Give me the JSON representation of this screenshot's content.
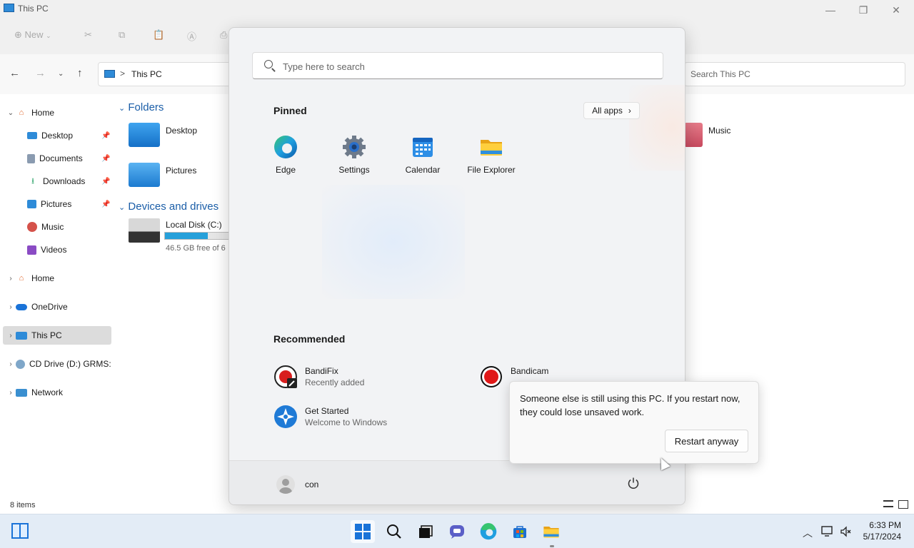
{
  "explorer": {
    "title": "This PC",
    "toolbar": {
      "new_label": "New"
    },
    "address": {
      "crumb": "This PC",
      "separator": ">"
    },
    "search_placeholder": "Search This PC",
    "nav": {
      "items": [
        {
          "label": "Home",
          "pinned": false
        },
        {
          "label": "Desktop",
          "pinned": true
        },
        {
          "label": "Documents",
          "pinned": true
        },
        {
          "label": "Downloads",
          "pinned": true
        },
        {
          "label": "Pictures",
          "pinned": true
        },
        {
          "label": "Music",
          "pinned": false
        },
        {
          "label": "Videos",
          "pinned": false
        },
        {
          "label": "Home",
          "pinned": false
        },
        {
          "label": "OneDrive",
          "pinned": false
        },
        {
          "label": "This PC",
          "pinned": false
        },
        {
          "label": "CD Drive (D:) GRMS:",
          "pinned": false
        },
        {
          "label": "Network",
          "pinned": false
        }
      ]
    },
    "groups": {
      "folders": "Folders",
      "devices": "Devices and drives"
    },
    "folders": [
      "Desktop",
      "Pictures",
      "Music"
    ],
    "drive": {
      "name": "Local Disk (C:)",
      "free": "46.5 GB free of 6",
      "used_fraction": 0.67
    },
    "status": {
      "items": "8 items"
    }
  },
  "start": {
    "search_placeholder": "Type here to search",
    "pinned_title": "Pinned",
    "all_apps": "All apps",
    "pinned": [
      "Edge",
      "Settings",
      "Calendar",
      "File Explorer"
    ],
    "recommended_title": "Recommended",
    "recommended": [
      {
        "name": "BandiFix",
        "sub": "Recently added"
      },
      {
        "name": "Bandicam",
        "sub": ""
      },
      {
        "name": "Get Started",
        "sub": "Welcome to Windows"
      }
    ],
    "user": "con"
  },
  "flyout": {
    "message": "Someone else is still using this PC. If you restart now, they could lose unsaved work.",
    "button": "Restart anyway"
  },
  "taskbar": {
    "time": "6:33 PM",
    "date": "5/17/2024"
  },
  "colors": {
    "accent": "#0067c0",
    "folder_header": "#1b5ea8",
    "drive_fill": "#26a0da"
  }
}
